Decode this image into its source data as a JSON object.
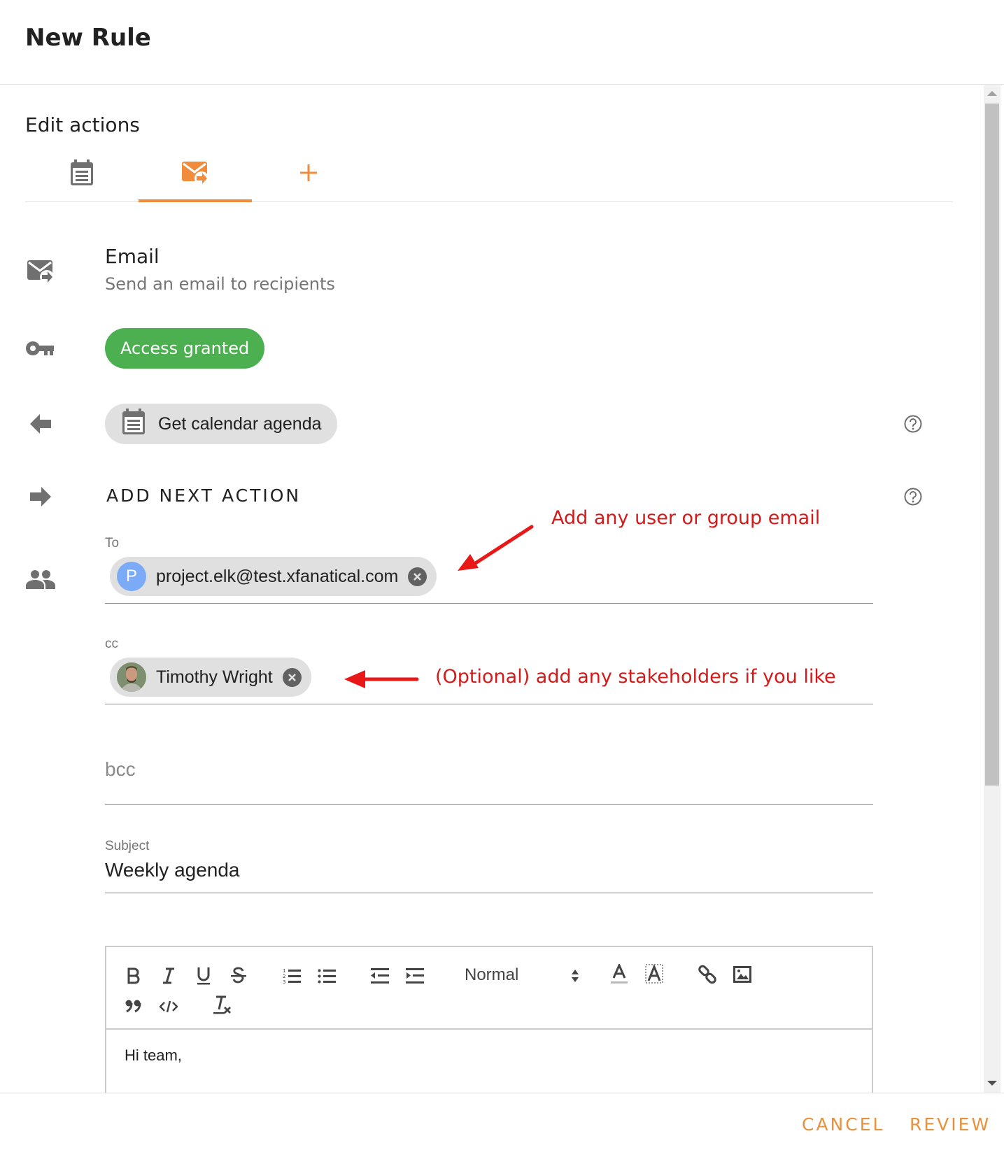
{
  "dialog": {
    "title": "New Rule"
  },
  "section": {
    "title": "Edit actions"
  },
  "tabs": [
    {
      "icon": "calendar-icon",
      "label": "Calendar action",
      "active": false
    },
    {
      "icon": "email-forward-icon",
      "label": "Email action",
      "active": true
    },
    {
      "icon": "plus-icon",
      "label": "Add action",
      "active": false
    }
  ],
  "colors": {
    "accent": "#f08c3c",
    "success": "#4caf50",
    "annotation": "#d31a1a",
    "chip_bg": "#e0e0e0",
    "avatar_blue": "#7baaf7"
  },
  "action": {
    "title": "Email",
    "subtitle": "Send an email to recipients",
    "access_badge": "Access granted",
    "input_from": "Get calendar agenda",
    "next_action_label": "ADD NEXT ACTION"
  },
  "form": {
    "to": {
      "label": "To",
      "chips": [
        {
          "avatar_letter": "P",
          "value": "project.elk@test.xfanatical.com"
        }
      ]
    },
    "cc": {
      "label": "cc",
      "chips": [
        {
          "avatar": "photo",
          "value": "Timothy Wright"
        }
      ]
    },
    "bcc": {
      "placeholder": "bcc",
      "value": ""
    },
    "subject": {
      "label": "Subject",
      "value": "Weekly agenda"
    }
  },
  "editor": {
    "toolbar": {
      "buttons": [
        "bold",
        "italic",
        "underline",
        "strike",
        "ordered-list",
        "bullet-list",
        "outdent",
        "indent",
        "text-color",
        "background-color",
        "link",
        "image",
        "blockquote",
        "code-block",
        "clear-format"
      ],
      "format_select": "Normal"
    },
    "body": "Hi team,"
  },
  "annotations": {
    "to_hint": "Add any user or group email",
    "cc_hint": "(Optional) add any stakeholders if you like"
  },
  "footer": {
    "cancel_label": "CANCEL",
    "review_label": "REVIEW"
  }
}
